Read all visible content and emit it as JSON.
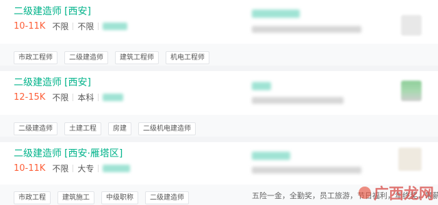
{
  "jobs": [
    {
      "title": "二级建造师",
      "location": "[西安]",
      "salary": "10-11K",
      "experience": "不限",
      "education": "不限",
      "tags": [
        "市政工程师",
        "二级建造师",
        "建筑工程师",
        "机电工程师"
      ],
      "benefits": ""
    },
    {
      "title": "二级建造师",
      "location": "[西安]",
      "salary": "12-15K",
      "experience": "不限",
      "education": "本科",
      "tags": [
        "二级建造师",
        "土建工程",
        "房建",
        "二级机电建造师"
      ],
      "benefits": ""
    },
    {
      "title": "二级建造师",
      "location": "[西安·雁塔区]",
      "salary": "10-11K",
      "experience": "不限",
      "education": "大专",
      "tags": [
        "市政工程",
        "建筑施工",
        "中级职称",
        "二级建造师"
      ],
      "benefits": "五险一金，全勤奖，员工旅游，节日福利，年终奖，带薪..."
    }
  ],
  "watermark": "广西龙网",
  "colors": {
    "accent": "#00b38a",
    "salary": "#fd5f39",
    "watermark": "#d9534f"
  }
}
